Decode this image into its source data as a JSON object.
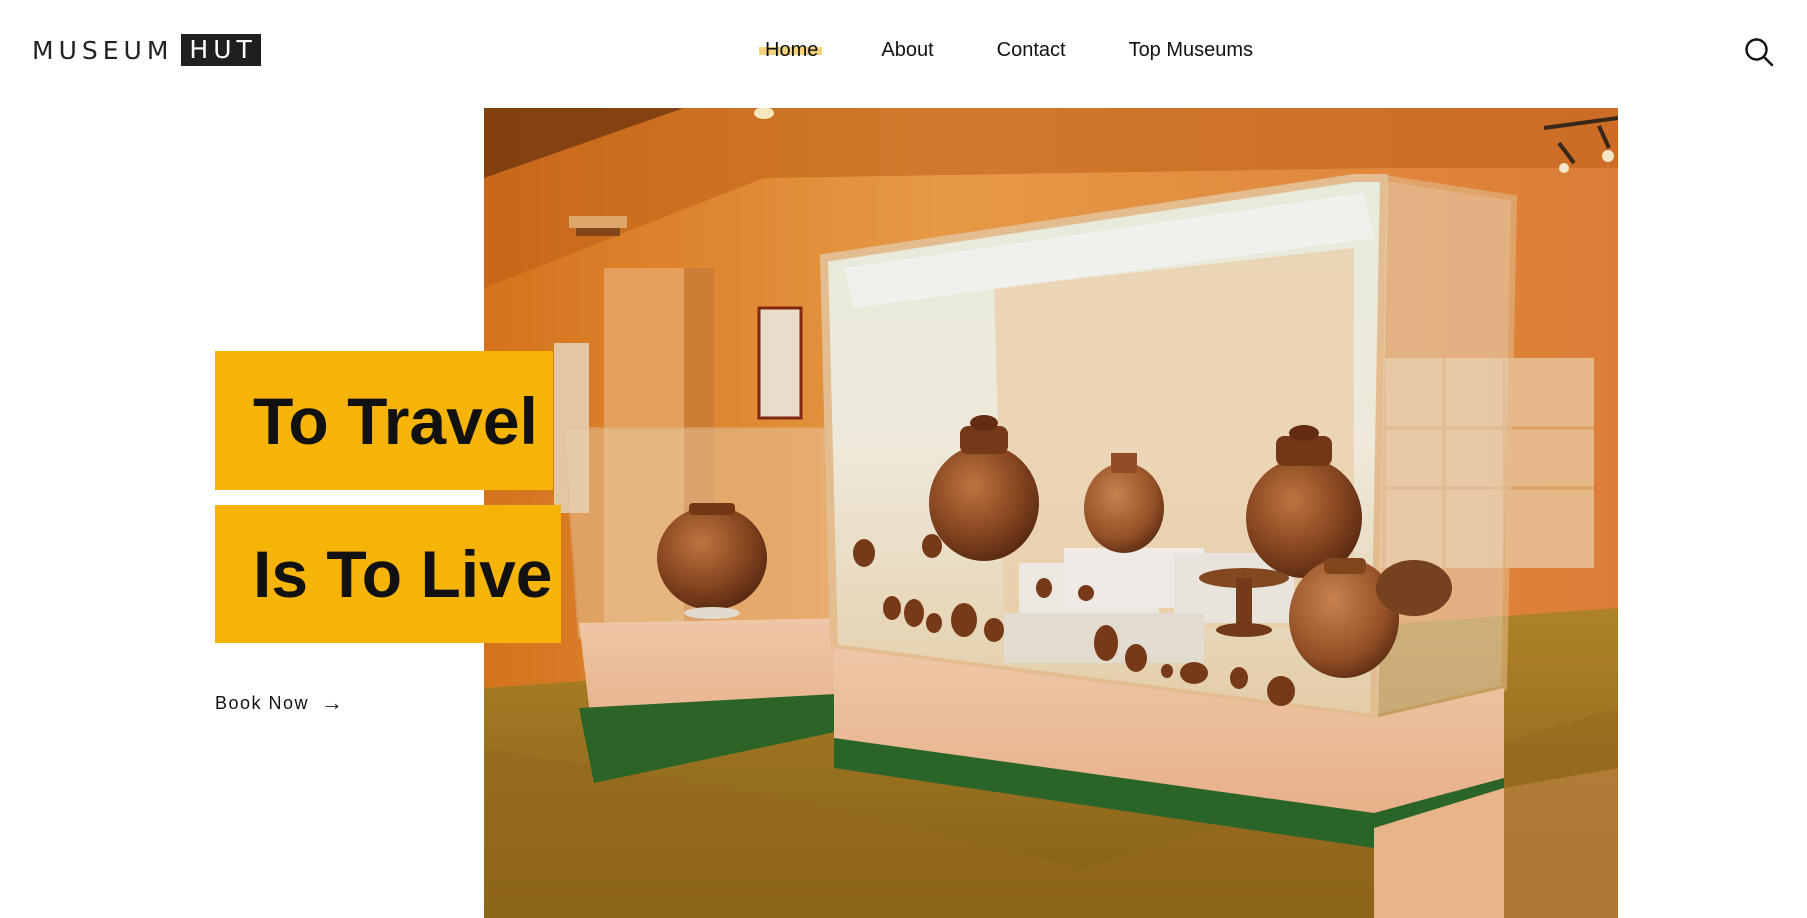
{
  "header": {
    "logo": {
      "main": "MUSEUM",
      "box": "HUT"
    },
    "nav": [
      {
        "label": "Home",
        "active": true
      },
      {
        "label": "About",
        "active": false
      },
      {
        "label": "Contact",
        "active": false
      },
      {
        "label": "Top Museums",
        "active": false
      }
    ],
    "search_icon": "search-icon"
  },
  "hero": {
    "headline_line_1": "To Travel",
    "headline_line_2": "Is To Live",
    "cta_label": "Book Now",
    "cta_arrow": "→",
    "image_subject": "museum gallery with pottery display cases",
    "accent_color": "#f6b407",
    "nav_highlight_color": "#f5d37a"
  }
}
